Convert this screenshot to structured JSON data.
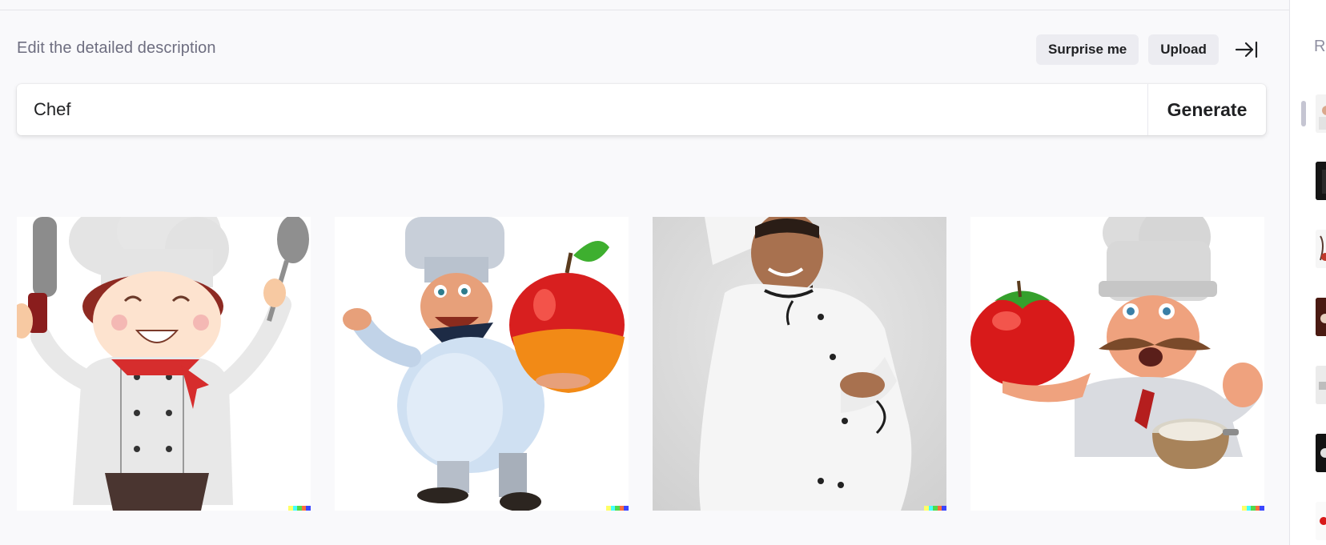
{
  "main": {
    "description_label": "Edit the detailed description",
    "actions": {
      "surprise_label": "Surprise me",
      "upload_label": "Upload"
    },
    "prompt": {
      "value": "Chef",
      "generate_label": "Generate"
    },
    "results": [
      {
        "subject": "cartoon chef with knife and ladle"
      },
      {
        "subject": "3D chef holding apple"
      },
      {
        "subject": "chef photo with crossed arms"
      },
      {
        "subject": "3D chef with tomato and pot"
      }
    ],
    "badge_colors": [
      "#ffff66",
      "#42ffff",
      "#51da4c",
      "#ff6e3c",
      "#3c46ff"
    ]
  },
  "sidebar": {
    "title": "R",
    "history_count": 8
  },
  "icons": {
    "collapse": "arrow-right-to-bar-icon"
  },
  "colors": {
    "background": "#f9f9fb",
    "pill": "#ececf1",
    "text": "#202123",
    "muted": "#6e6e80"
  }
}
